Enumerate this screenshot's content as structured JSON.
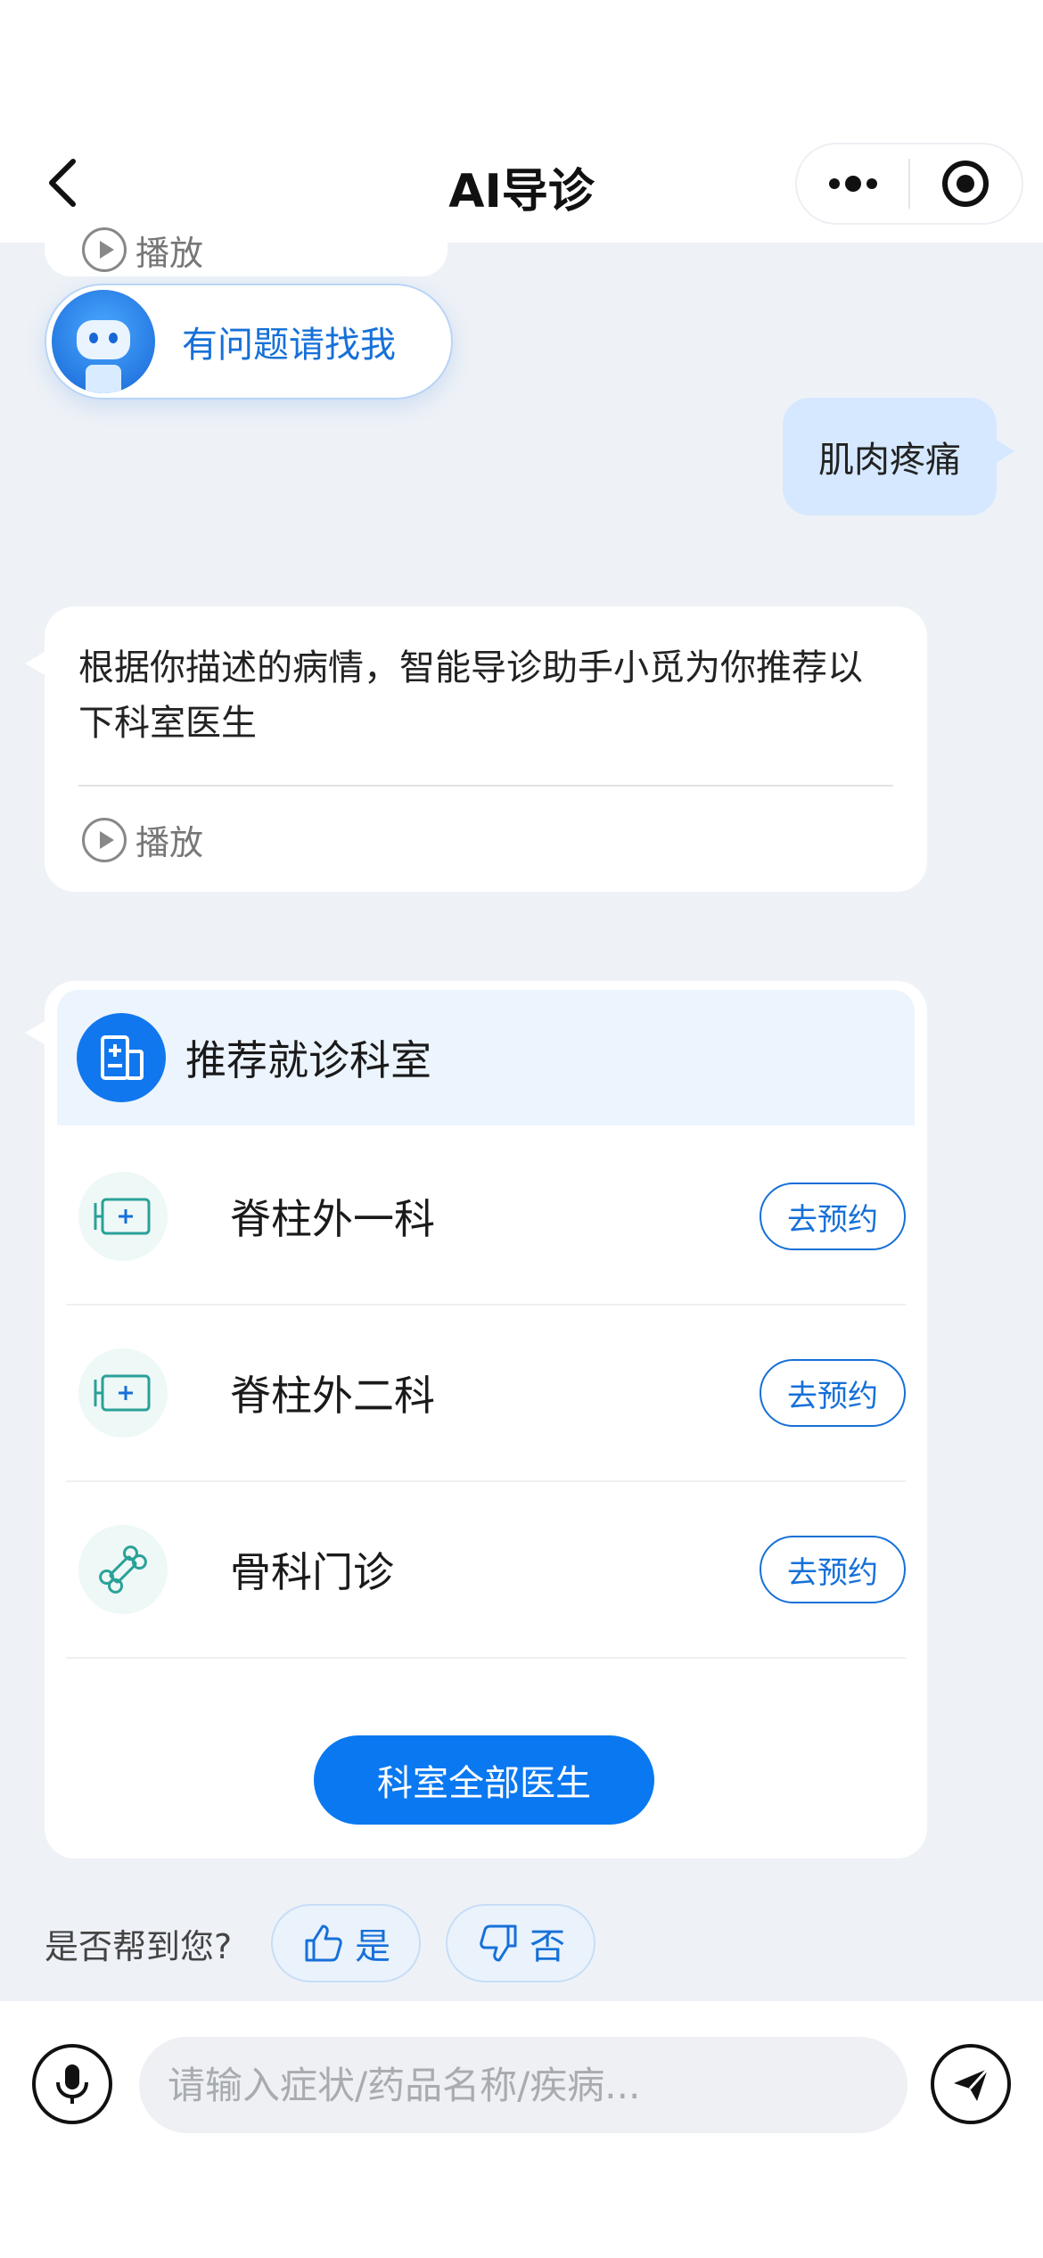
{
  "header": {
    "title": "AI导诊",
    "back_icon": "chevron-left-icon",
    "more_icon": "more-dots-icon",
    "close_icon": "target-icon"
  },
  "prev_message": {
    "play_label": "播放"
  },
  "helper": {
    "text": "有问题请找我",
    "avatar": "robot-avatar"
  },
  "user_message": {
    "text": "肌肉疼痛"
  },
  "bot_message": {
    "text": "根据你描述的病情，智能导诊助手小觅为你推荐以下科室医生",
    "play_label": "播放"
  },
  "dept_card": {
    "title": "推荐就诊科室",
    "departments": [
      {
        "name": "脊柱外一科",
        "icon": "clinic-icon",
        "action": "去预约"
      },
      {
        "name": "脊柱外二科",
        "icon": "clinic-icon",
        "action": "去预约"
      },
      {
        "name": "骨科门诊",
        "icon": "bone-icon",
        "action": "去预约"
      }
    ],
    "all_doctors_label": "科室全部医生"
  },
  "feedback": {
    "question": "是否帮到您?",
    "yes_label": "是",
    "no_label": "否"
  },
  "input_bar": {
    "placeholder": "请输入症状/药品名称/疾病..."
  },
  "colors": {
    "accent": "#0a78f0",
    "link": "#1670d8",
    "user_bubble": "#d6e8ff",
    "background": "#eef2f7"
  }
}
